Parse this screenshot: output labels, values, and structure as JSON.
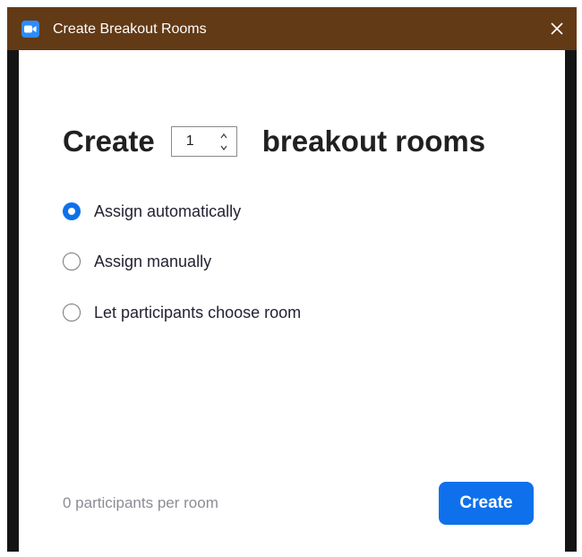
{
  "window": {
    "title": "Create Breakout Rooms"
  },
  "icons": {
    "app": "zoom-camera-icon",
    "close": "close-icon",
    "spin_up": "chevron-up-icon",
    "spin_down": "chevron-down-icon"
  },
  "heading": {
    "prefix": "Create",
    "room_count": "1",
    "suffix": "breakout rooms"
  },
  "options": [
    {
      "label": "Assign automatically",
      "selected": true
    },
    {
      "label": "Assign manually",
      "selected": false
    },
    {
      "label": "Let participants choose room",
      "selected": false
    }
  ],
  "footer": {
    "per_room_text": "0 participants per room",
    "create_label": "Create"
  },
  "colors": {
    "titlebar": "#633a16",
    "accent": "#0e71eb",
    "app_icon": "#2d8cff"
  }
}
